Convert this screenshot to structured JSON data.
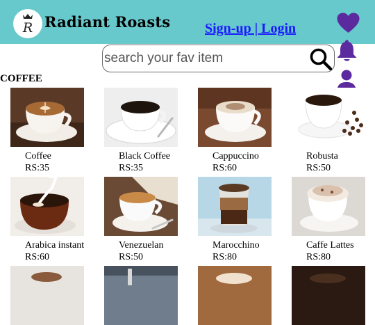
{
  "header": {
    "brand": "Radiant Roasts",
    "auth": {
      "signup": "Sign-up",
      "separator": " | ",
      "login": "Login"
    },
    "icons": [
      "heart-icon",
      "bell-icon",
      "user-icon"
    ],
    "accent_color": "#5b2a9e",
    "background_color": "#68c9cc"
  },
  "search": {
    "placeholder": "search your fav item"
  },
  "section": {
    "title": "COFFEE"
  },
  "products": [
    {
      "name": "Coffee",
      "price": "RS:35"
    },
    {
      "name": "Black Coffee",
      "price": "RS:35"
    },
    {
      "name": "Cappuccino",
      "price": "RS:60"
    },
    {
      "name": "Robusta",
      "price": "RS:50"
    },
    {
      "name": "Arabica instant",
      "price": "RS:60"
    },
    {
      "name": "Venezuelan",
      "price": "RS:50"
    },
    {
      "name": "Marocchino",
      "price": "RS:80"
    },
    {
      "name": "Caffe Lattes",
      "price": "RS:80"
    },
    {
      "name": "",
      "price": ""
    },
    {
      "name": "",
      "price": ""
    },
    {
      "name": "",
      "price": ""
    },
    {
      "name": "",
      "price": ""
    }
  ]
}
